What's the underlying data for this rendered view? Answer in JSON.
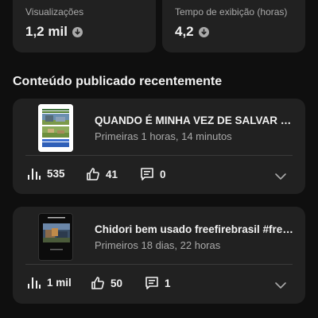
{
  "stats": {
    "views": {
      "label": "Visualizações",
      "value": "1,2 mil",
      "trend": "down"
    },
    "watch_time": {
      "label": "Tempo de exibição (horas)",
      "value": "4,2",
      "trend": "down"
    }
  },
  "recent_content": {
    "title": "Conteúdo publicado recentemente",
    "videos": [
      {
        "title": "QUANDO É MINHA VEZ DE SALVAR  #freefire",
        "subtitle": "Primeiras 1 horas, 14 minutos",
        "views": "535",
        "likes": "41",
        "comments": "0"
      },
      {
        "title": "Chidori bem usado freefirebrasil #freefire",
        "subtitle": "Primeiros 18 dias, 22 horas",
        "views": "1 mil",
        "likes": "50",
        "comments": "1"
      }
    ]
  },
  "colors": {
    "background": "#0f0f0f",
    "card": "#212121",
    "text_primary": "#f1f1f1",
    "text_secondary": "#aaaaaa"
  }
}
